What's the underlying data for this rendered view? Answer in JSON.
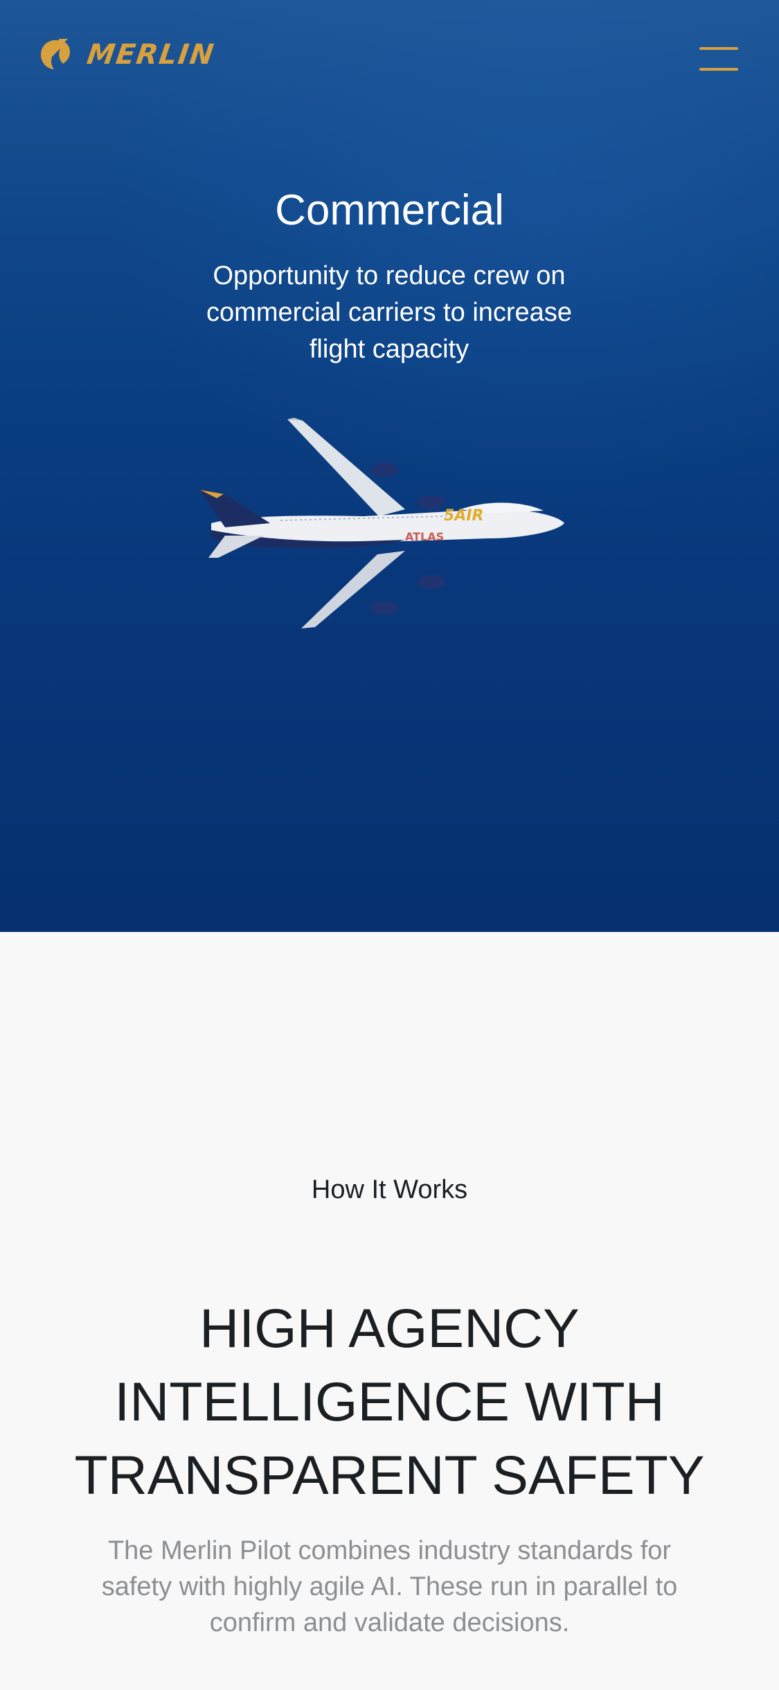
{
  "header": {
    "brand": "MERLIN",
    "logo_icon": "merlin-bird-logo-icon",
    "menu_icon": "hamburger-menu-icon",
    "accent_color": "#d9a13e"
  },
  "hero": {
    "title": "Commercial",
    "subtitle": "Opportunity to reduce crew on commercial carriers to increase flight capacity",
    "image": "commercial-airliner-image",
    "background_color": "#0b3f82"
  },
  "how_it_works": {
    "eyebrow": "How It Works",
    "heading": "HIGH AGENCY INTELLIGENCE WITH TRANSPARENT SAFETY",
    "body": "The Merlin Pilot combines industry standards for safety with highly agile AI. These run in parallel to confirm and validate decisions."
  }
}
